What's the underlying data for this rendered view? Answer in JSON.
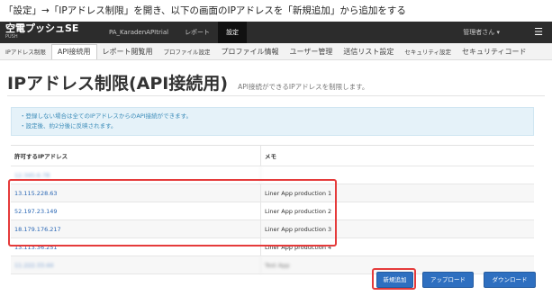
{
  "instruction": "「設定」→「IPアドレス制限」を開き、以下の画面のIPアドレスを「新規追加」から追加をする",
  "header": {
    "brand": "空電プッシュSE",
    "brand_sub": "PUSH",
    "nav": [
      "PA_KaradenAPItrial",
      "レポート",
      "設定"
    ],
    "active_nav": "設定",
    "user": "管理者さん ▾",
    "menu_icon": "hamburger-icon"
  },
  "tabs": [
    "IPアドレス制限",
    "API接続用",
    "レポート閲覧用",
    "プロファイル設定",
    "プロファイル情報",
    "ユーザー管理",
    "送信リスト設定",
    "セキュリティ設定",
    "セキュリティコード"
  ],
  "active_tab": "API接続用",
  "page": {
    "title": "IPアドレス制限(API接続用)",
    "subtitle": "API接続ができるIPアドレスを制限します。"
  },
  "info": {
    "line1": "・登録しない場合は全てのIPアドレスからのAPI接続ができます。",
    "line2": "・設定後、約2分後に反映されます。"
  },
  "table": {
    "headers": [
      "許可するIPアドレス",
      "メモ"
    ],
    "rows": [
      {
        "ip": "12.345.6.78",
        "memo": "",
        "obscured": true
      },
      {
        "ip": "13.115.228.63",
        "memo": "Liner App production 1",
        "obscured": false
      },
      {
        "ip": "52.197.23.149",
        "memo": "Liner App production 2",
        "obscured": false
      },
      {
        "ip": "18.179.176.217",
        "memo": "Liner App production 3",
        "obscured": false
      },
      {
        "ip": "13.113.36.251",
        "memo": "Liner App production 4",
        "obscured": false
      },
      {
        "ip": "11.222.33.44",
        "memo": "Test App",
        "obscured": true
      }
    ]
  },
  "buttons": {
    "new": "新規追加",
    "upload": "アップロード",
    "download": "ダウンロード"
  },
  "colors": {
    "highlight": "#e53b3b",
    "button": "#2e6fc0",
    "link": "#2a67b5",
    "info_bg": "#e5f2f9"
  }
}
